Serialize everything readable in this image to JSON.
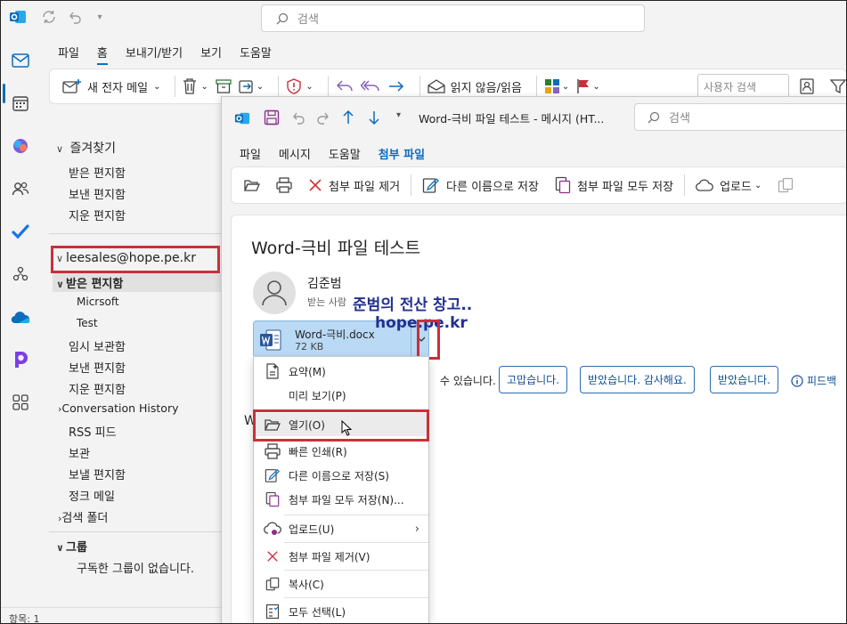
{
  "outer": {
    "search_placeholder": "검색",
    "tabs": [
      "파일",
      "홈",
      "보내기/받기",
      "보기",
      "도움말"
    ],
    "selected_tab": "홈",
    "toolbar": {
      "new_mail": "새 전자 메일",
      "unread_read": "읽지 않음/읽음",
      "user_search_placeholder": "사용자 검색"
    }
  },
  "folders": {
    "favorites_header": "즐겨찾기",
    "favorites": [
      "받은 편지함",
      "보낸 편지함",
      "지운 편지함"
    ],
    "account": "leesales@hope.pe.kr",
    "inbox": "받은 편지함",
    "inbox_children": [
      "Micrsoft",
      "Test"
    ],
    "items": [
      "임시 보관함",
      "보낸 편지함",
      "지운 편지함",
      "Conversation History",
      "RSS 피드",
      "보관",
      "보낼 편지함",
      "정크 메일",
      "검색 폴더"
    ],
    "groups_header": "그룹",
    "groups_empty": "구독한 그룹이 없습니다.",
    "status": "항목: 1"
  },
  "message_window": {
    "title": "Word-극비 파일 테스트  -  메시지 (HT...",
    "search_placeholder": "검색",
    "tabs": [
      "파일",
      "메시지",
      "도움말",
      "첨부 파일"
    ],
    "selected_tab": "첨부 파일",
    "toolbar": {
      "remove": "첨부 파일 제거",
      "save_as": "다른 이름으로 저장",
      "save_all": "첨부 파일 모두 저장",
      "upload": "업로드"
    },
    "subject": "Word-극비 파일 테스트",
    "sender": "김준범",
    "recipients": "받는 사람",
    "attachment": {
      "name": "Word-극비.docx",
      "size": "72 KB"
    },
    "reply_hint": "수 있습니다.",
    "quick_replies": [
      "고맙습니다.",
      "받았습니다. 감사해요.",
      "받았습니다."
    ],
    "feedback": "피드백",
    "body_initial": "W"
  },
  "watermark": {
    "line1": "준범의 전산 창고..",
    "line2": "hope.pe.kr"
  },
  "context_menu": {
    "items": [
      {
        "label": "요약(M)",
        "icon": "summary-icon"
      },
      {
        "label": "미리 보기(P)",
        "icon": ""
      },
      {
        "label": "열기(O)",
        "icon": "open-folder-icon"
      },
      {
        "label": "빠른 인쇄(R)",
        "icon": "print-icon"
      },
      {
        "label": "다른 이름으로 저장(S)",
        "icon": "save-as-icon"
      },
      {
        "label": "첨부 파일 모두 저장(N)...",
        "icon": "save-all-icon"
      },
      {
        "label": "업로드(U)",
        "icon": "upload-icon"
      },
      {
        "label": "첨부 파일 제거(V)",
        "icon": "remove-icon"
      },
      {
        "label": "복사(C)",
        "icon": "copy-icon"
      },
      {
        "label": "모두 선택(L)",
        "icon": "select-all-icon"
      }
    ]
  },
  "colors": {
    "accent": "#0f6cbd",
    "highlight_box": "#c8313a",
    "watermark": "#23308f",
    "attachment_chip": "#b9d9f4"
  }
}
